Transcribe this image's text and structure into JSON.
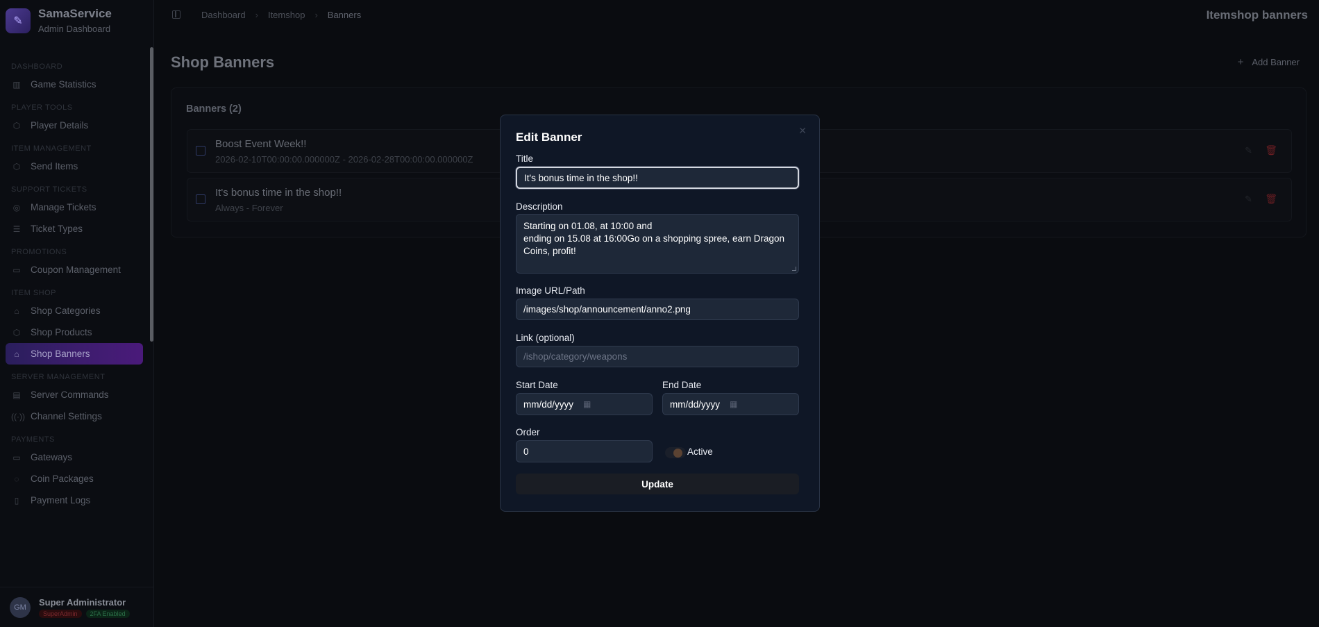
{
  "brand": {
    "name": "SamaService",
    "subtitle": "Admin Dashboard",
    "logo_icon": "pen-icon"
  },
  "sidebar": {
    "sections": [
      {
        "title": "DASHBOARD",
        "items": [
          {
            "label": "Game Statistics",
            "icon": "bar-chart-icon"
          }
        ]
      },
      {
        "title": "PLAYER TOOLS",
        "items": [
          {
            "label": "Player Details",
            "icon": "cube-icon"
          }
        ]
      },
      {
        "title": "ITEM MANAGEMENT",
        "items": [
          {
            "label": "Send Items",
            "icon": "cube-icon"
          }
        ]
      },
      {
        "title": "SUPPORT TICKETS",
        "items": [
          {
            "label": "Manage Tickets",
            "icon": "lifebuoy-icon"
          },
          {
            "label": "Ticket Types",
            "icon": "sliders-icon"
          }
        ]
      },
      {
        "title": "PROMOTIONS",
        "items": [
          {
            "label": "Coupon Management",
            "icon": "ticket-icon"
          }
        ]
      },
      {
        "title": "ITEM SHOP",
        "items": [
          {
            "label": "Shop Categories",
            "icon": "store-icon"
          },
          {
            "label": "Shop Products",
            "icon": "cube-icon"
          },
          {
            "label": "Shop Banners",
            "icon": "store-icon",
            "active": true
          }
        ]
      },
      {
        "title": "SERVER MANAGEMENT",
        "items": [
          {
            "label": "Server Commands",
            "icon": "terminal-icon"
          },
          {
            "label": "Channel Settings",
            "icon": "broadcast-icon"
          }
        ]
      },
      {
        "title": "PAYMENTS",
        "items": [
          {
            "label": "Gateways",
            "icon": "card-icon"
          },
          {
            "label": "Coin Packages",
            "icon": "coins-icon"
          },
          {
            "label": "Payment Logs",
            "icon": "receipt-icon"
          }
        ]
      }
    ],
    "user": {
      "initials": "GM",
      "name": "Super Administrator",
      "role_badge": "SuperAdmin",
      "twofa_badge": "2FA Enabled"
    }
  },
  "topbar": {
    "breadcrumb": [
      "Dashboard",
      "Itemshop",
      "Banners"
    ],
    "title": "Itemshop banners"
  },
  "main": {
    "page_title": "Shop Banners",
    "add_button": "Add Banner",
    "card_title": "Banners (2)",
    "banners": [
      {
        "title": "Boost Event Week!!",
        "dates": "2026-02-10T00:00:00.000000Z - 2026-02-28T00:00:00.000000Z"
      },
      {
        "title": "It's bonus time in the shop!!",
        "dates": "Always - Forever"
      }
    ]
  },
  "modal": {
    "title": "Edit Banner",
    "title_label": "Title",
    "title_value": "It's bonus time in the shop!!",
    "description_label": "Description",
    "description_value": "Starting on 01.08, at 10:00 and\nending on 15.08 at 16:00Go on a shopping spree, earn Dragon Coins, profit!",
    "image_label": "Image URL/Path",
    "image_value": "/images/shop/announcement/anno2.png",
    "link_label": "Link (optional)",
    "link_placeholder": "/ishop/category/weapons",
    "start_date_label": "Start Date",
    "start_date_value": "mm/dd/yyyy",
    "end_date_label": "End Date",
    "end_date_value": "mm/dd/yyyy",
    "order_label": "Order",
    "order_value": "0",
    "active_label": "Active",
    "active": false,
    "update_button": "Update"
  },
  "colors": {
    "accent": "#4a1a7a",
    "modal_bg": "#0f1726",
    "danger": "#6a1e23"
  }
}
